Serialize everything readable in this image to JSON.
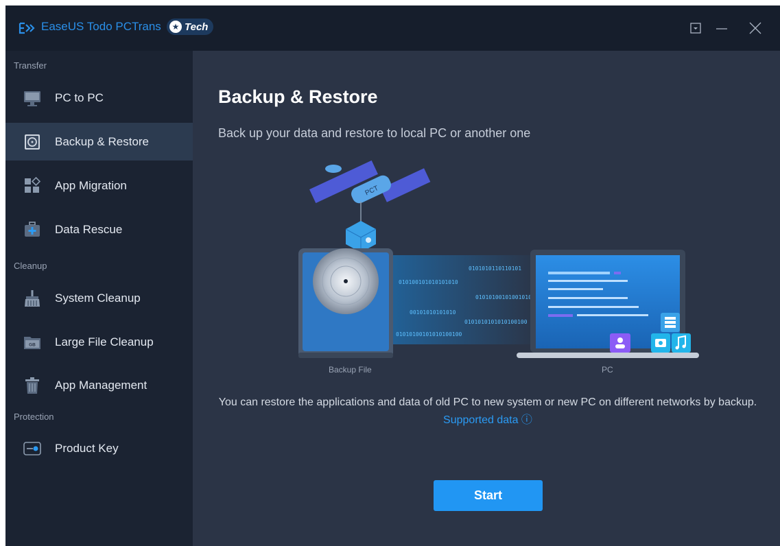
{
  "app": {
    "name": "EaseUS Todo PCTrans",
    "edition": "Tech",
    "controls": [
      "menu-icon",
      "minimize-icon",
      "close-icon"
    ]
  },
  "sidebar": {
    "sections": [
      {
        "label": "Transfer",
        "items": [
          {
            "label": "PC to PC",
            "icon": "monitor-icon"
          },
          {
            "label": "Backup & Restore",
            "icon": "backup-icon",
            "active": true
          },
          {
            "label": "App Migration",
            "icon": "app-grid-icon"
          },
          {
            "label": "Data Rescue",
            "icon": "rescue-kit-icon"
          }
        ]
      },
      {
        "label": "Cleanup",
        "items": [
          {
            "label": "System Cleanup",
            "icon": "broom-icon"
          },
          {
            "label": "Large File Cleanup",
            "icon": "folder-gb-icon"
          },
          {
            "label": "App Management",
            "icon": "trash-icon"
          }
        ]
      },
      {
        "label": "Protection",
        "items": [
          {
            "label": "Product Key",
            "icon": "key-icon"
          }
        ]
      }
    ]
  },
  "main": {
    "title": "Backup & Restore",
    "subtitle": "Back up your data and restore to local PC or another one",
    "illustration": {
      "left_caption": "Backup File",
      "right_caption": "PC",
      "satellite_label": "PCT",
      "binary_lines": [
        "010100101010101010",
        "0101010110110101",
        "00101010101010",
        "0101010101010100100",
        "01010100101001010",
        "01010100101010100100"
      ]
    },
    "description": "You can restore the applications and data of old PC to new system or new PC on different networks by backup.",
    "supported_link": "Supported data",
    "start_label": "Start"
  },
  "colors": {
    "accent": "#2196f3",
    "sidebar_bg": "#1b2332",
    "active_item": "#2c3b50",
    "main_bg": "#2b3446",
    "titlebar": "#161e2c"
  }
}
